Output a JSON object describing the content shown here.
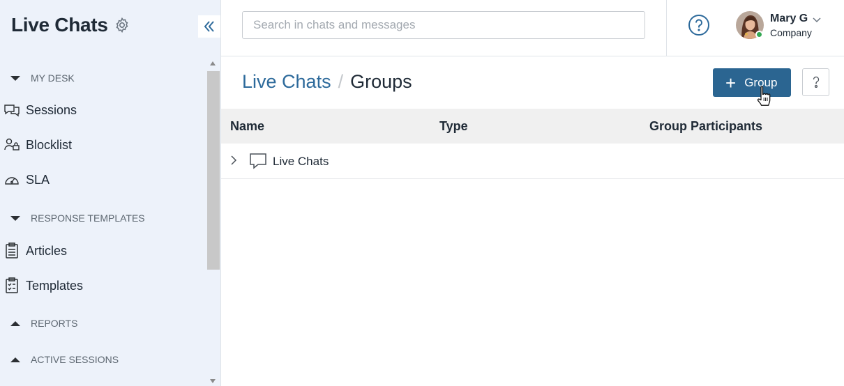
{
  "sidebar": {
    "title": "Live Chats",
    "sections": [
      {
        "label": "MY DESK",
        "expanded": true
      },
      {
        "label": "RESPONSE TEMPLATES",
        "expanded": true
      },
      {
        "label": "REPORTS",
        "expanded": false
      },
      {
        "label": "ACTIVE SESSIONS",
        "expanded": false
      }
    ],
    "items": [
      {
        "label": "Sessions",
        "icon": "chat-bubbles-icon"
      },
      {
        "label": "Blocklist",
        "icon": "user-lock-icon"
      },
      {
        "label": "SLA",
        "icon": "gauge-icon"
      },
      {
        "label": "Articles",
        "icon": "clipboard-icon"
      },
      {
        "label": "Templates",
        "icon": "clipboard-list-icon"
      }
    ]
  },
  "header": {
    "search_placeholder": "Search in chats and messages",
    "user": {
      "name": "Mary G",
      "company": "Company",
      "status": "online"
    }
  },
  "page": {
    "breadcrumb_root": "Live Chats",
    "breadcrumb_sep": "/",
    "title": "Groups",
    "add_button_label": "Group"
  },
  "table": {
    "columns": [
      "Name",
      "Type",
      "Group Participants"
    ],
    "rows": [
      {
        "name": "Live Chats",
        "type": "",
        "participants": ""
      }
    ]
  },
  "colors": {
    "accent": "#2b6591",
    "link": "#2d6a9b",
    "sidebar_bg": "#edf2fa",
    "online": "#34a853"
  }
}
